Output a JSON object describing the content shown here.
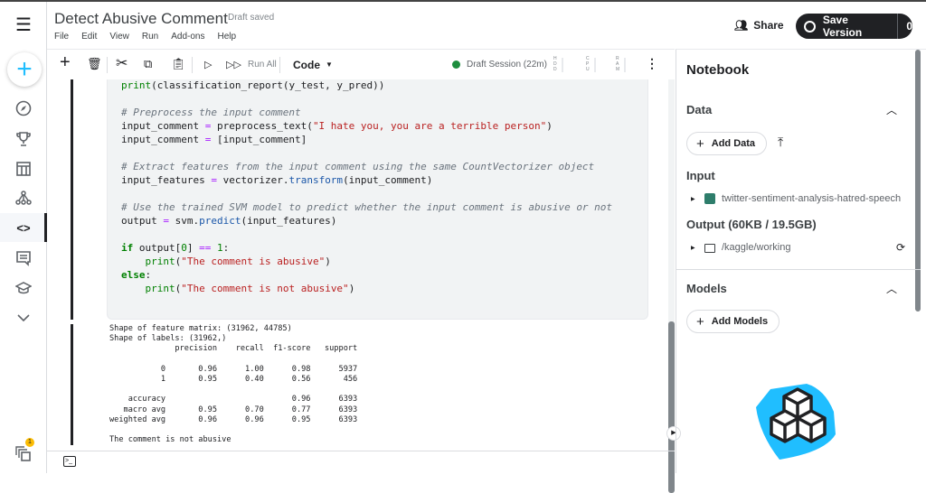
{
  "app": {
    "title": "Detect Abusive Comment",
    "status": "Draft saved",
    "menu": [
      "File",
      "Edit",
      "View",
      "Run",
      "Add-ons",
      "Help"
    ],
    "share": "Share",
    "save_version": "Save Version",
    "version_count": "0",
    "notification_badge": "1"
  },
  "sidebar": {
    "items": [
      "create",
      "compass",
      "trophy",
      "table",
      "models",
      "code",
      "discussion",
      "learn",
      "more"
    ],
    "active": "code"
  },
  "toolbar": {
    "run_all": "Run All",
    "cell_type": "Code",
    "session": "Draft Session (22m)",
    "session_color": "#1e8e3e",
    "meters": [
      "HDD",
      "CPU",
      "RAM"
    ]
  },
  "code_lines": [
    [
      [
        "fn",
        "print"
      ],
      [
        "",
        "(classification_report(y_test, y_pred))"
      ]
    ],
    [],
    [
      [
        "cm",
        "# Preprocess the input comment"
      ]
    ],
    [
      [
        "",
        "input_comment "
      ],
      [
        "op",
        "="
      ],
      [
        "",
        " preprocess_text("
      ],
      [
        "st",
        "\"I hate you, you are a terrible person\""
      ],
      [
        "",
        ")"
      ]
    ],
    [
      [
        "",
        "input_comment "
      ],
      [
        "op",
        "="
      ],
      [
        "",
        " [input_comment]"
      ]
    ],
    [],
    [
      [
        "cm",
        "# Extract features from the input comment using the same CountVectorizer object"
      ]
    ],
    [
      [
        "",
        "input_features "
      ],
      [
        "op",
        "="
      ],
      [
        "",
        " vectorizer."
      ],
      [
        "at",
        "transform"
      ],
      [
        "",
        "(input_comment)"
      ]
    ],
    [],
    [
      [
        "cm",
        "# Use the trained SVM model to predict whether the input comment is abusive or not"
      ]
    ],
    [
      [
        "",
        "output "
      ],
      [
        "op",
        "="
      ],
      [
        "",
        " svm."
      ],
      [
        "at",
        "predict"
      ],
      [
        "",
        "(input_features)"
      ]
    ],
    [],
    [
      [
        "kw",
        "if"
      ],
      [
        "",
        " output["
      ],
      [
        "nu",
        "0"
      ],
      [
        "",
        "] "
      ],
      [
        "op",
        "=="
      ],
      [
        "",
        " "
      ],
      [
        "nu",
        "1"
      ],
      [
        "",
        ":"
      ]
    ],
    [
      [
        "",
        "    "
      ],
      [
        "fn",
        "print"
      ],
      [
        "",
        "("
      ],
      [
        "st",
        "\"The comment is abusive\""
      ],
      [
        "",
        ")"
      ]
    ],
    [
      [
        "kw",
        "else"
      ],
      [
        "",
        ":"
      ]
    ],
    [
      [
        "",
        "    "
      ],
      [
        "fn",
        "print"
      ],
      [
        "",
        "("
      ],
      [
        "st",
        "\"The comment is not abusive\""
      ],
      [
        "",
        ")"
      ]
    ]
  ],
  "output_lines": [
    "Shape of feature matrix: (31962, 44785)",
    "Shape of labels: (31962,)",
    "              precision    recall  f1-score   support",
    "",
    "           0       0.96      1.00      0.98      5937",
    "           1       0.95      0.40      0.56       456",
    "",
    "    accuracy                           0.96      6393",
    "   macro avg       0.95      0.70      0.77      6393",
    "weighted avg       0.96      0.96      0.95      6393",
    "",
    "The comment is not abusive"
  ],
  "panel": {
    "title": "Notebook",
    "data_heading": "Data",
    "add_data": "Add Data",
    "input_heading": "Input",
    "input_dataset": "twitter-sentiment-analysis-hatred-speech",
    "output_heading": "Output (60KB / 19.5GB)",
    "output_path": "/kaggle/working",
    "models_heading": "Models",
    "add_models": "Add Models"
  },
  "colors": {
    "accent": "#20beff",
    "dark": "#202124"
  }
}
